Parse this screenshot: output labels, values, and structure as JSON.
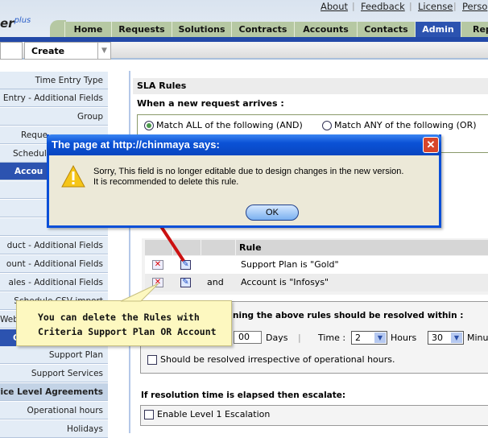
{
  "top_links": [
    "About",
    "Feedback",
    "License",
    "Perso"
  ],
  "logo": {
    "text": "er",
    "sup": "plus"
  },
  "tabs": [
    {
      "label": "Home"
    },
    {
      "label": "Requests"
    },
    {
      "label": "Solutions"
    },
    {
      "label": "Contracts"
    },
    {
      "label": "Accounts"
    },
    {
      "label": "Contacts"
    },
    {
      "label": "Admin",
      "active": true
    },
    {
      "label": "Rep"
    }
  ],
  "create": {
    "label": "Create"
  },
  "sidebar": [
    "Time Entry Type",
    "Entry - Additional Fields",
    "Group",
    "Reque",
    "Schedul",
    "Accou",
    "",
    "",
    "",
    "duct - Additional Fields",
    "ount - Additional Fields",
    "ales - Additional Fields",
    "Schedule CSV import",
    "Webl",
    "C",
    "Support Plan",
    "Support Services",
    "vice Level Agreements",
    "Operational hours",
    "Holidays"
  ],
  "sla": {
    "title": "SLA Rules",
    "when": "When a new request arrives :",
    "match_all": "Match ALL of the following (AND)",
    "match_any": "Match ANY of the following (OR)",
    "selected": "all",
    "rule_header": "Rule",
    "rules": [
      {
        "conj": "",
        "text": "Support Plan is \"Gold\""
      },
      {
        "conj": "and",
        "text": "Account is \"Infosys\""
      }
    ],
    "resolve_text": "ning the above rules should be resolved within :",
    "days_value": "00",
    "days_label": "Days",
    "time_label": "Time :",
    "hours_value": "2",
    "hours_label": "Hours",
    "minutes_value": "30",
    "minutes_label": "Minu",
    "irrespective": "Should be resolved irrespective of operational hours.",
    "escalate_title": "If resolution time is elapsed then escalate:",
    "escalation1": "Enable Level 1 Escalation"
  },
  "dialog": {
    "title": "The page at http://chinmaya says:",
    "line1": "Sorry, This field is no longer editable due to design changes in the new version.",
    "line2": "It is recommended to delete this rule.",
    "ok": "OK"
  },
  "tooltip": {
    "line1": "You can delete the Rules with",
    "line2": "Criteria Support Plan OR Account"
  },
  "colors": {
    "tab_active": "#2c53b0",
    "tab": "#b6c8a3",
    "dialog_title": "#0b52d6",
    "tooltip": "#fdf8c0",
    "arrow": "#cc1111"
  }
}
